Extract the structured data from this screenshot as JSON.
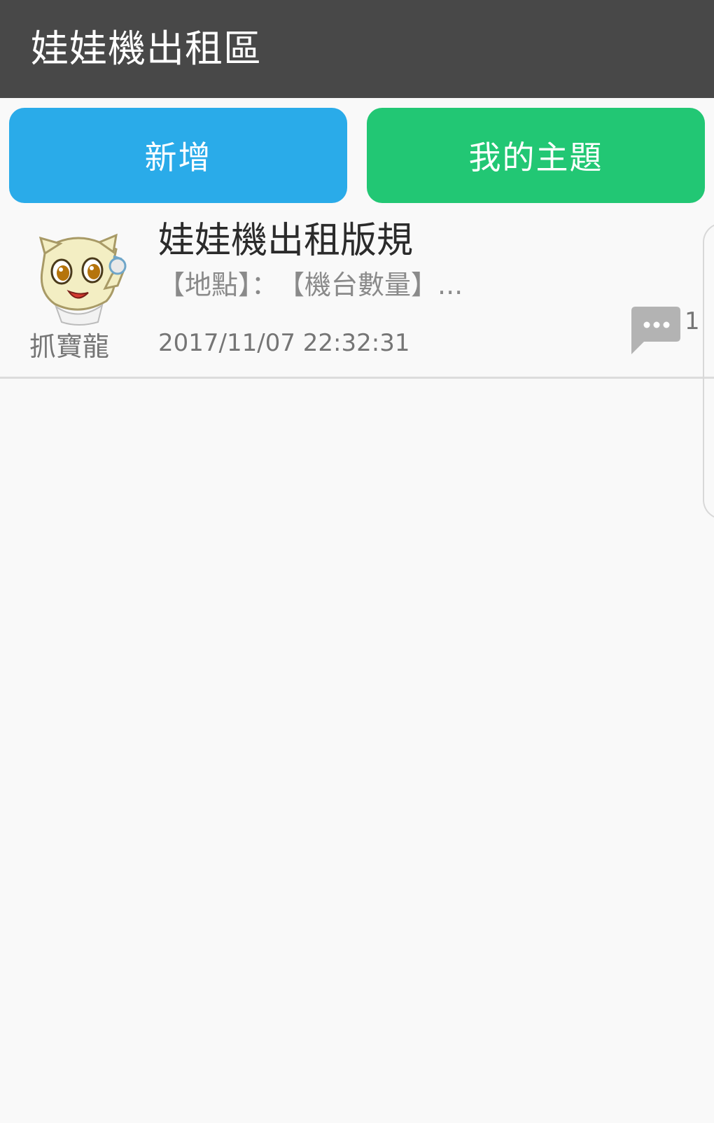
{
  "app": {
    "title": "娃娃機出租區"
  },
  "actions": {
    "add_label": "新增",
    "my_topics_label": "我的主題"
  },
  "posts": [
    {
      "author": "抓寶龍",
      "title": "娃娃機出租版規",
      "snippet": "【地點】：　【機台數量】...",
      "timestamp": "2017/11/07 22:32:31",
      "comment_count": "1"
    }
  ],
  "colors": {
    "appbar": "#484848",
    "add_button": "#2aabe9",
    "my_topics_button": "#22c774",
    "background": "#f9f9f9"
  },
  "icons": {
    "avatar": "cartoon-creature-avatar",
    "comments": "comment-bubble-icon"
  }
}
